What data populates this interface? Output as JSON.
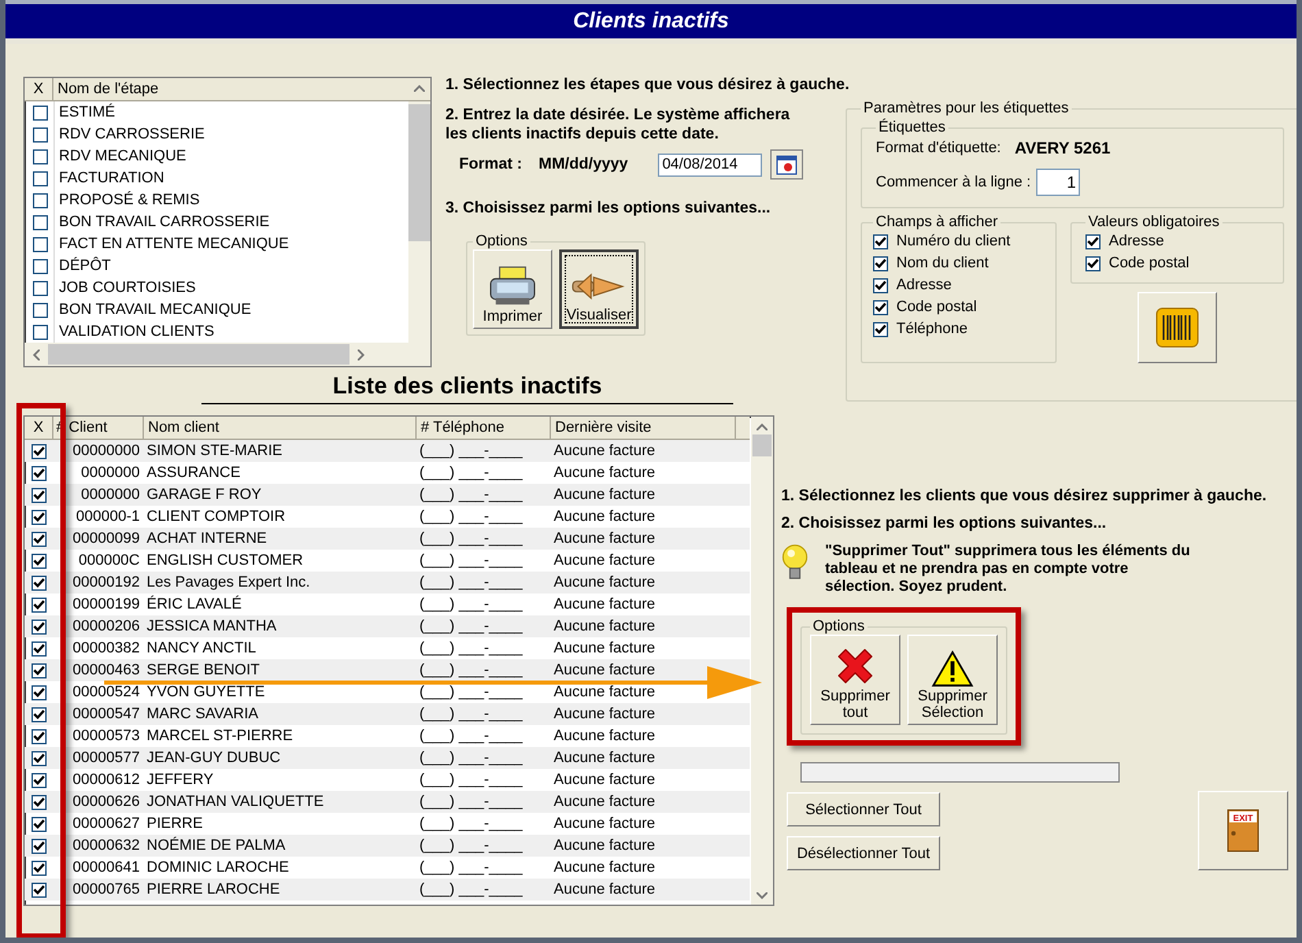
{
  "window": {
    "title": "Clients inactifs"
  },
  "stages": {
    "columns": [
      "X",
      "Nom de l'étape"
    ],
    "items": [
      {
        "name": "ESTIMÉ",
        "checked": false
      },
      {
        "name": "RDV CARROSSERIE",
        "checked": false
      },
      {
        "name": "RDV MECANIQUE",
        "checked": false
      },
      {
        "name": "FACTURATION",
        "checked": false
      },
      {
        "name": "PROPOSÉ & REMIS",
        "checked": false
      },
      {
        "name": "BON TRAVAIL CARROSSERIE",
        "checked": false
      },
      {
        "name": "FACT EN ATTENTE MECANIQUE",
        "checked": false
      },
      {
        "name": "DÉPÔT",
        "checked": false
      },
      {
        "name": "JOB COURTOISIES",
        "checked": false
      },
      {
        "name": "BON TRAVAIL MECANIQUE",
        "checked": false
      },
      {
        "name": "VALIDATION CLIENTS",
        "checked": false
      }
    ]
  },
  "instructions": {
    "step1": "1. Sélectionnez les étapes que vous désirez à gauche.",
    "step2": "2. Entrez la date désirée. Le système affichera les clients inactifs depuis cette date.",
    "format_label": "Format :",
    "format_value": "MM/dd/yyyy",
    "date": "04/08/2014",
    "step3": "3. Choisissez parmi les options suivantes...",
    "options_title": "Options",
    "buttons": [
      {
        "label": "Imprimer",
        "kind": "print",
        "focused": false
      },
      {
        "label": "Visualiser",
        "kind": "view",
        "focused": true
      }
    ]
  },
  "labels": {
    "title": "Paramètres pour les étiquettes",
    "etiquettes_title": "Étiquettes",
    "format_label": "Format d'étiquette:",
    "format_value": "AVERY 5261",
    "start_label": "Commencer à la ligne :",
    "start_value": "1",
    "fields_title": "Champs à afficher",
    "fields": [
      {
        "label": "Numéro du client",
        "checked": true
      },
      {
        "label": "Nom du client",
        "checked": true
      },
      {
        "label": "Adresse",
        "checked": true
      },
      {
        "label": "Code postal",
        "checked": true
      },
      {
        "label": "Téléphone",
        "checked": true
      }
    ],
    "required_title": "Valeurs obligatoires",
    "required": [
      {
        "label": "Adresse",
        "checked": true
      },
      {
        "label": "Code postal",
        "checked": true
      }
    ]
  },
  "clients": {
    "title": "Liste des clients inactifs",
    "columns": [
      "X",
      "# Client",
      "Nom client",
      "# Téléphone",
      "Dernière visite"
    ],
    "rows": [
      {
        "checked": true,
        "id": "00000000",
        "name": "SIMON STE-MARIE",
        "phone": "(___) ___-____",
        "last_visit": "Aucune facture"
      },
      {
        "checked": true,
        "id": "0000000",
        "name": "ASSURANCE",
        "phone": "(___) ___-____",
        "last_visit": "Aucune facture"
      },
      {
        "checked": true,
        "id": "0000000",
        "name": "GARAGE F ROY",
        "phone": "(___) ___-____",
        "last_visit": "Aucune facture"
      },
      {
        "checked": true,
        "id": "000000-1",
        "name": "CLIENT COMPTOIR",
        "phone": "(___) ___-____",
        "last_visit": "Aucune facture"
      },
      {
        "checked": true,
        "id": "00000099",
        "name": "ACHAT INTERNE",
        "phone": "(___) ___-____",
        "last_visit": "Aucune facture"
      },
      {
        "checked": true,
        "id": "000000C",
        "name": "ENGLISH CUSTOMER",
        "phone": "(___) ___-____",
        "last_visit": "Aucune facture"
      },
      {
        "checked": true,
        "id": "00000192",
        "name": "Les Pavages Expert Inc.",
        "phone": "(___) ___-____",
        "last_visit": "Aucune facture"
      },
      {
        "checked": true,
        "id": "00000199",
        "name": "ÉRIC LAVALÉ",
        "phone": "(___) ___-____",
        "last_visit": "Aucune facture"
      },
      {
        "checked": true,
        "id": "00000206",
        "name": "JESSICA MANTHA",
        "phone": "(___) ___-____",
        "last_visit": "Aucune facture"
      },
      {
        "checked": true,
        "id": "00000382",
        "name": "NANCY ANCTIL",
        "phone": "(___) ___-____",
        "last_visit": "Aucune facture"
      },
      {
        "checked": true,
        "id": "00000463",
        "name": "SERGE BENOIT",
        "phone": "(___) ___-____",
        "last_visit": "Aucune facture"
      },
      {
        "checked": true,
        "id": "00000524",
        "name": "YVON GUYETTE",
        "phone": "(___) ___-____",
        "last_visit": "Aucune facture"
      },
      {
        "checked": true,
        "id": "00000547",
        "name": "MARC SAVARIA",
        "phone": "(___) ___-____",
        "last_visit": "Aucune facture"
      },
      {
        "checked": true,
        "id": "00000573",
        "name": "MARCEL ST-PIERRE",
        "phone": "(___) ___-____",
        "last_visit": "Aucune facture"
      },
      {
        "checked": true,
        "id": "00000577",
        "name": "JEAN-GUY DUBUC",
        "phone": "(___) ___-____",
        "last_visit": "Aucune facture"
      },
      {
        "checked": true,
        "id": "00000612",
        "name": "JEFFERY",
        "phone": "(___) ___-____",
        "last_visit": "Aucune facture"
      },
      {
        "checked": true,
        "id": "00000626",
        "name": "JONATHAN VALIQUETTE",
        "phone": "(___) ___-____",
        "last_visit": "Aucune facture"
      },
      {
        "checked": true,
        "id": "00000627",
        "name": "PIERRE",
        "phone": "(___) ___-____",
        "last_visit": "Aucune facture"
      },
      {
        "checked": true,
        "id": "00000632",
        "name": "NOÉMIE DE PALMA",
        "phone": "(___) ___-____",
        "last_visit": "Aucune facture"
      },
      {
        "checked": true,
        "id": "00000641",
        "name": "DOMINIC LAROCHE",
        "phone": "(___) ___-____",
        "last_visit": "Aucune facture"
      },
      {
        "checked": true,
        "id": "00000765",
        "name": "PIERRE LAROCHE",
        "phone": "(___) ___-____",
        "last_visit": "Aucune facture"
      }
    ]
  },
  "delete": {
    "step1": "1. Sélectionnez les clients que vous désirez supprimer à gauche.",
    "step2": "2. Choisissez parmi les options suivantes...",
    "tip": "\"Supprimer Tout\" supprimera tous les éléments du tableau et ne prendra pas en compte votre sélection. Soyez prudent.",
    "options_title": "Options",
    "buttons": [
      {
        "label": "Supprimer tout",
        "kind": "delete_all"
      },
      {
        "label": "Supprimer Sélection",
        "kind": "delete_selection"
      }
    ],
    "progress": {
      "level": 0
    },
    "exit_label": "EXIT",
    "select_all": "Sélectionner Tout",
    "deselect_all": "Désélectionner Tout"
  }
}
